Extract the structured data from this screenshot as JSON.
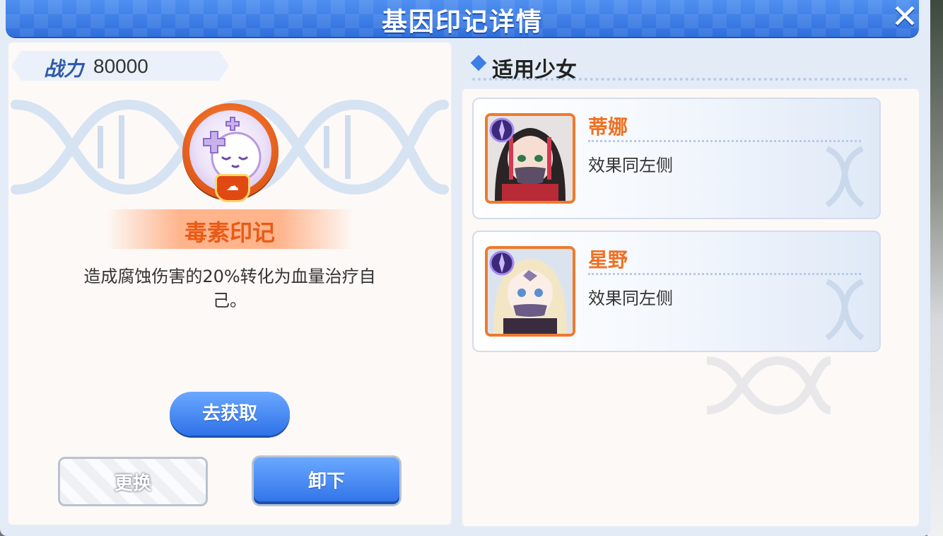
{
  "dialog": {
    "title": "基因印记详情",
    "close_label": "✕"
  },
  "imprint": {
    "power_label": "战力",
    "power_value": "80000",
    "name": "毒素印记",
    "description": "造成腐蚀伤害的20%转化为血量治疗自己。"
  },
  "buttons": {
    "obtain": "去获取",
    "replace": "更换",
    "unequip": "卸下"
  },
  "applicable": {
    "section_title": "适用少女",
    "characters": [
      {
        "name": "蒂娜",
        "effect": "效果同左侧"
      },
      {
        "name": "星野",
        "effect": "效果同左侧"
      }
    ]
  },
  "colors": {
    "header_blue": "#2f6fdc",
    "accent_orange": "#ea5a16",
    "button_blue": "#2f72e8"
  }
}
